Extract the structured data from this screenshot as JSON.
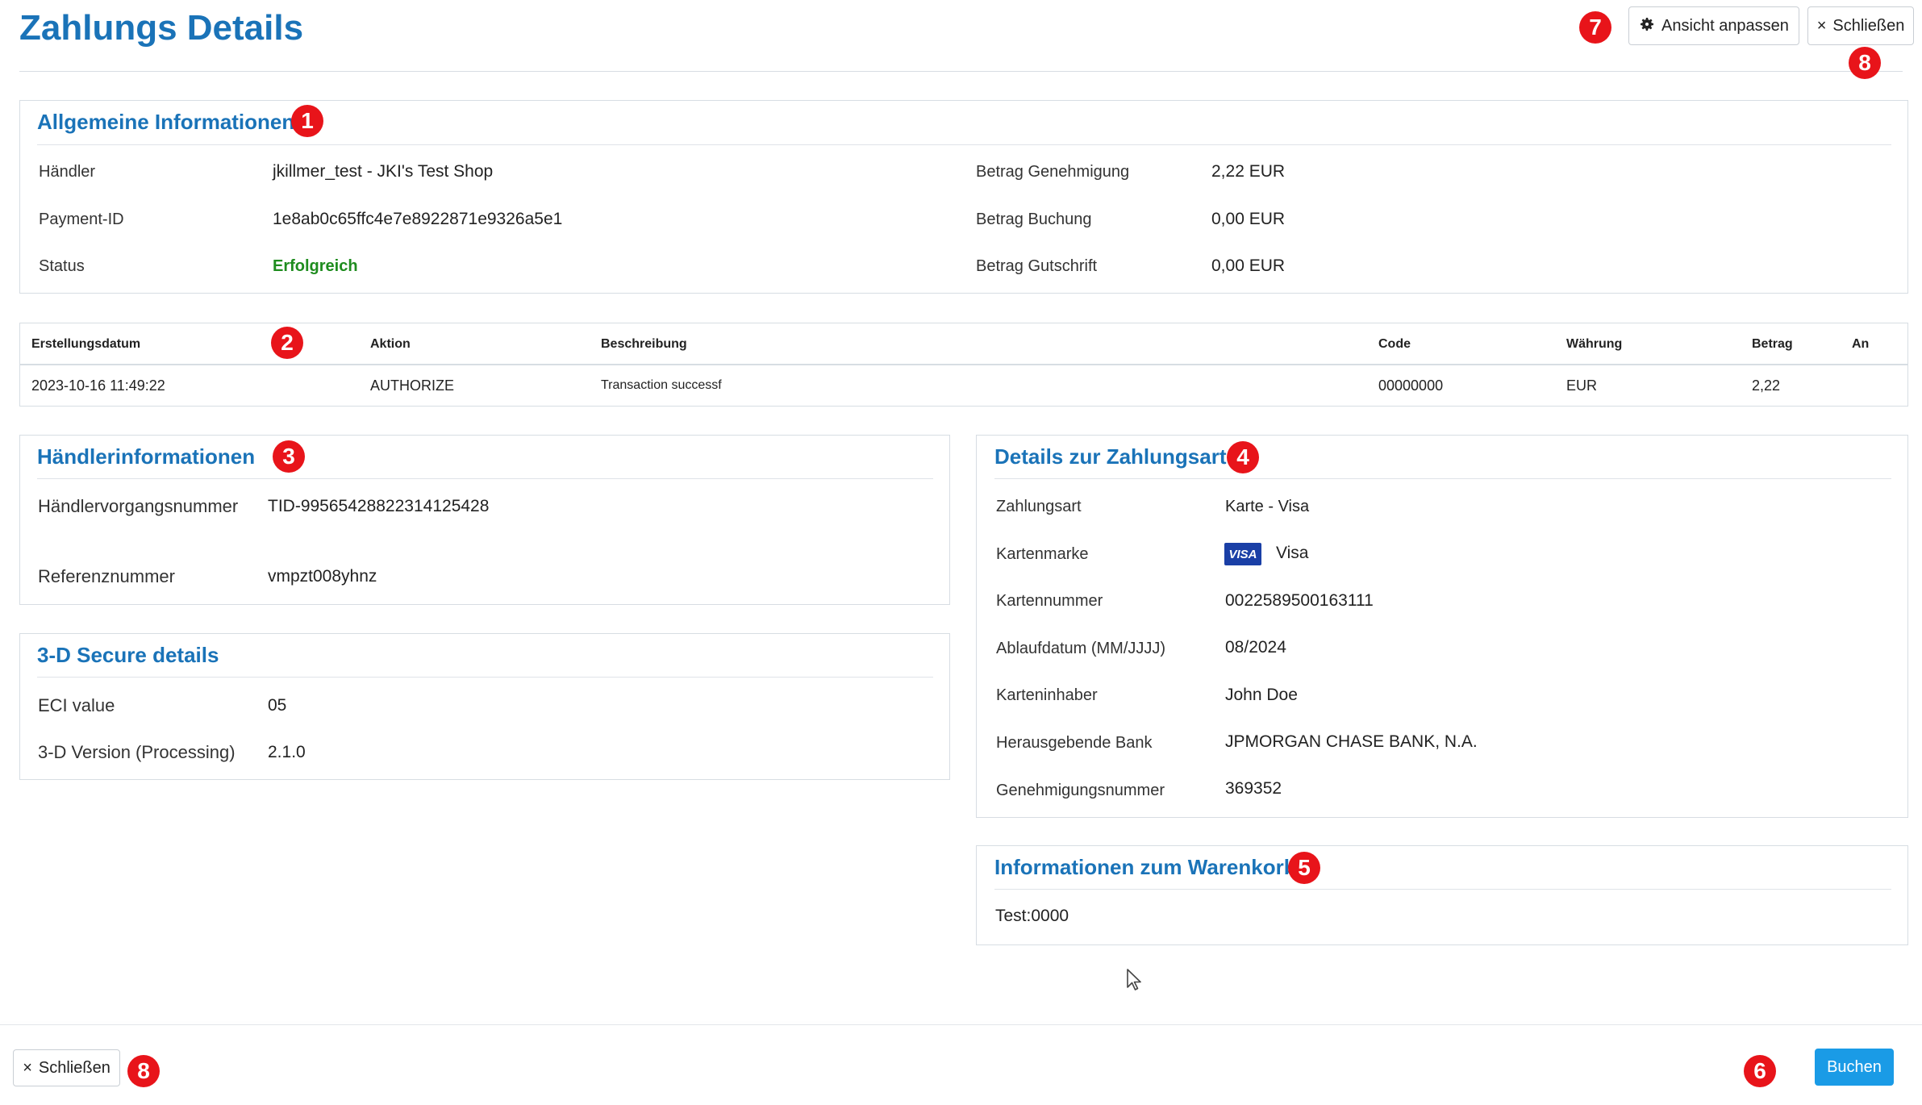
{
  "header": {
    "title": "Zahlungs Details",
    "view_button_label": "Ansicht anpassen",
    "close_button_label": "Schließen",
    "close_icon": "×"
  },
  "annotations": [
    "1",
    "2",
    "3",
    "4",
    "5",
    "6",
    "7",
    "8"
  ],
  "general": {
    "title": "Allgemeine Informationen",
    "rows_left": [
      {
        "label": "Händler",
        "value": "jkillmer_test - JKI's Test Shop"
      },
      {
        "label": "Payment-ID",
        "value": "1e8ab0c65ffc4e7e8922871e9326a5e1"
      },
      {
        "label": "Status",
        "value": "Erfolgreich"
      }
    ],
    "rows_right": [
      {
        "label": "Betrag Genehmigung",
        "value": "2,22 EUR"
      },
      {
        "label": "Betrag Buchung",
        "value": "0,00 EUR"
      },
      {
        "label": "Betrag Gutschrift",
        "value": "0,00 EUR"
      }
    ]
  },
  "transactions": {
    "columns": [
      "Erstellungsdatum",
      "Aktion",
      "Beschreibung",
      "Code",
      "Währung",
      "Betrag",
      "An"
    ],
    "rows": [
      [
        "2023-10-16 11:49:22",
        "AUTHORIZE",
        "Transaction successf",
        "00000000",
        "EUR",
        "2,22",
        ""
      ]
    ]
  },
  "merchant": {
    "title": "Händlerinformationen",
    "rows": [
      {
        "label": "Händlervorgangsnummer",
        "value": "TID-99565428822314125428"
      },
      {
        "label": "Referenznummer",
        "value": "vmpzt008yhnz"
      }
    ]
  },
  "secure3d": {
    "title": "3-D Secure details",
    "rows": [
      {
        "label": "ECI value",
        "value": "05"
      },
      {
        "label": "3-D Version (Processing)",
        "value": "2.1.0"
      }
    ]
  },
  "payment_method": {
    "title": "Details zur Zahlungsart",
    "rows": [
      {
        "label": "Zahlungsart",
        "value": "Karte - Visa"
      },
      {
        "label": "Kartenmarke",
        "value": "Visa",
        "logo": "VISA"
      },
      {
        "label": "Kartennummer",
        "value": "0022589500163111"
      },
      {
        "label": "Ablaufdatum (MM/JJJJ)",
        "value": "08/2024"
      },
      {
        "label": "Karteninhaber",
        "value": "John Doe"
      },
      {
        "label": "Herausgebende Bank",
        "value": "JPMORGAN CHASE BANK, N.A."
      },
      {
        "label": "Genehmigungsnummer",
        "value": "369352"
      }
    ]
  },
  "cart": {
    "title": "Informationen zum Warenkorb",
    "value": "Test:0000"
  },
  "footer": {
    "close_button_label": "Schließen",
    "close_icon": "×",
    "book_button_label": "Buchen"
  },
  "colors": {
    "accent": "#1a73b8",
    "primary_button": "#1a9be6",
    "badge": "#e8141a",
    "success": "#1e8c1e"
  },
  "icons": {
    "view_settings": "gear-icon",
    "close": "close-icon",
    "cursor": "mouse-cursor-icon"
  }
}
